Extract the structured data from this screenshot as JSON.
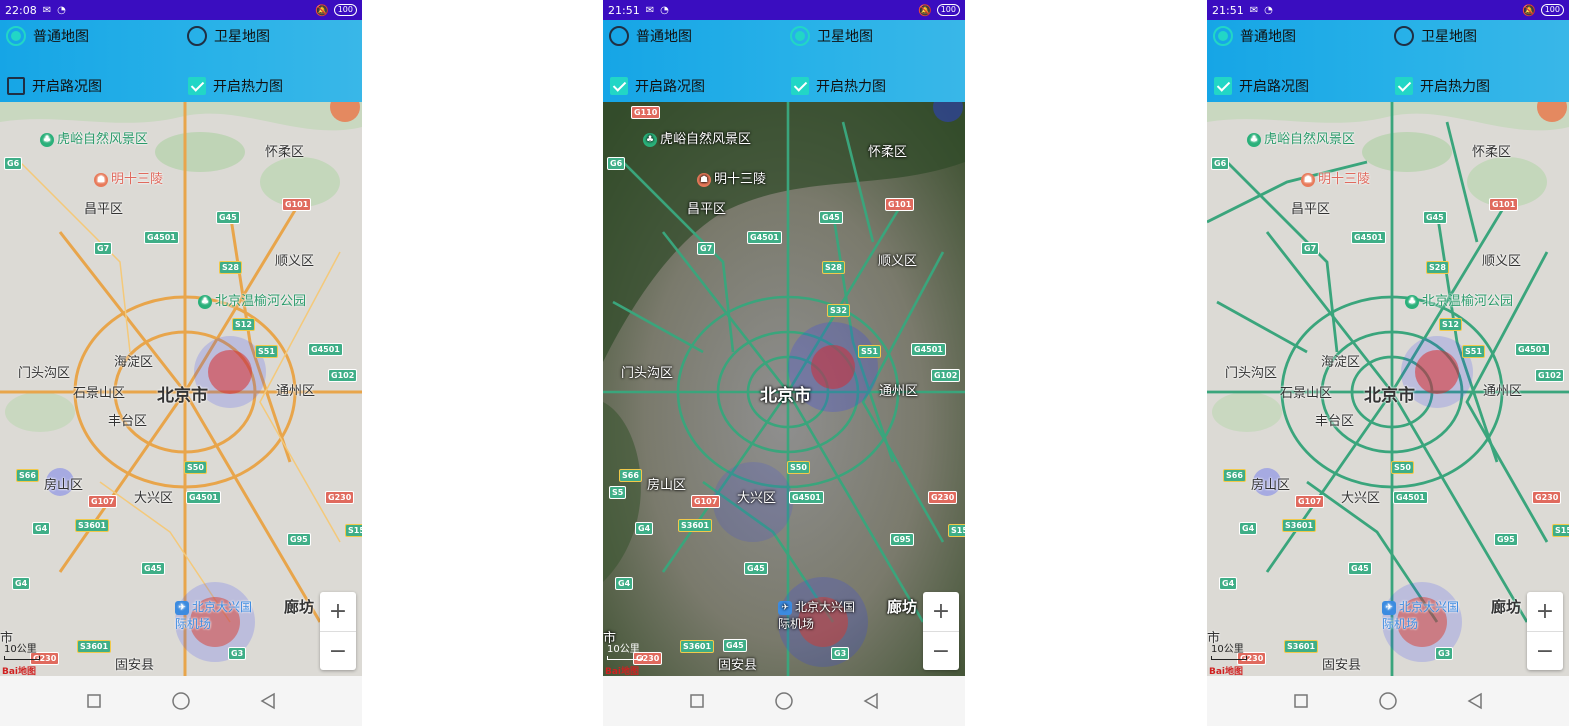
{
  "phones": [
    {
      "status_time": "22:08",
      "battery": "100",
      "radio_normal": {
        "label": "普通地图",
        "checked": true
      },
      "radio_satellite": {
        "label": "卫星地图",
        "checked": false
      },
      "traffic": {
        "label": "开启路况图",
        "checked": false
      },
      "heat": {
        "label": "开启热力图",
        "checked": true
      },
      "map_type": "normal"
    },
    {
      "status_time": "21:51",
      "battery": "100",
      "radio_normal": {
        "label": "普通地图",
        "checked": false
      },
      "radio_satellite": {
        "label": "卫星地图",
        "checked": true
      },
      "traffic": {
        "label": "开启路况图",
        "checked": true
      },
      "heat": {
        "label": "开启热力图",
        "checked": true
      },
      "map_type": "satellite"
    },
    {
      "status_time": "21:51",
      "battery": "100",
      "radio_normal": {
        "label": "普通地图",
        "checked": true
      },
      "radio_satellite": {
        "label": "卫星地图",
        "checked": false
      },
      "traffic": {
        "label": "开启路况图",
        "checked": true
      },
      "heat": {
        "label": "开启热力图",
        "checked": true
      },
      "map_type": "normal"
    }
  ],
  "map_labels": {
    "huyu": "虎峪自然风景区",
    "ming13": "明十三陵",
    "huairou": "怀柔区",
    "changping": "昌平区",
    "shunyi": "顺义区",
    "wenyu": "北京温榆河公园",
    "haidian": "海淀区",
    "mentougou": "门头沟区",
    "shijingshan": "石景山区",
    "beijing": "北京市",
    "tongzhou": "通州区",
    "fengtai": "丰台区",
    "fangshan": "房山区",
    "daxing": "大兴区",
    "airport": "北京大兴国际机场",
    "langfang": "廊坊",
    "guan": "固安县",
    "shi": "市"
  },
  "shields": {
    "G6": "G6",
    "G110": "G110",
    "G45": "G45",
    "G101": "G101",
    "G7": "G7",
    "G4501": "G4501",
    "S28": "S28",
    "S12": "S12",
    "S51": "S51",
    "G102": "G102",
    "S32": "S32",
    "S66": "S66",
    "G107": "G107",
    "S50": "S50",
    "G230": "G230",
    "G4": "G4",
    "S3601": "S3601",
    "G95": "G95",
    "S15": "S15",
    "G3": "G3",
    "S5": "S5"
  },
  "zoom": {
    "in": "+",
    "out": "−"
  },
  "scale_label": "10公里",
  "logo": "Bai地图",
  "nav": {
    "recent": "recent-apps",
    "home": "home",
    "back": "back"
  },
  "colors": {
    "status_bar": "#3a0dc0",
    "accent": "#22d6c6",
    "traffic_green": "#3aa57c",
    "road_orange": "#e8a54b",
    "map_bg": "#dcdad5"
  }
}
